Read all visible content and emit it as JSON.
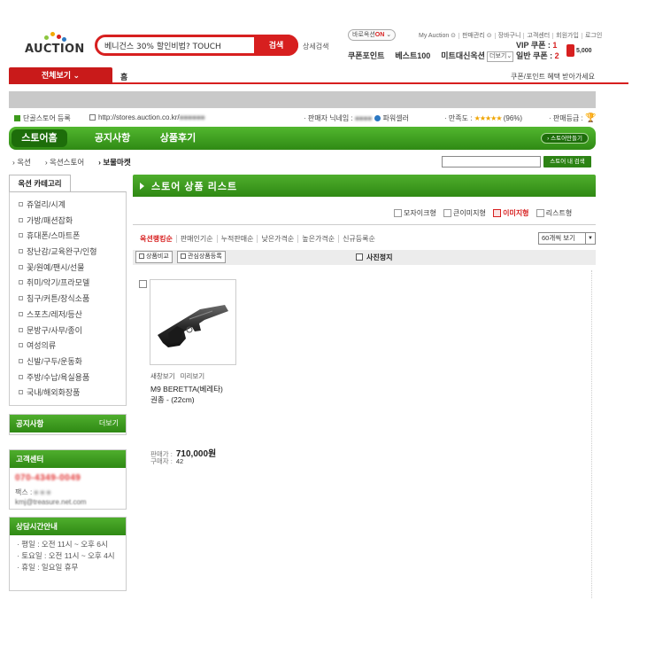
{
  "header": {
    "logo_text": "AUCTION",
    "logo_colors": [
      "#8cc63f",
      "#f2a900",
      "#d71f1f",
      "#2b78c2"
    ],
    "search_value": "베니건스 30% 할인비법? TOUCH",
    "search_button": "검색",
    "detail_search": "상세검색",
    "baro_label": "바로옥션",
    "baro_state": "ON",
    "util_nav": [
      "My Auction ⊙",
      "판매관리 ⊙",
      "장바구니",
      "고객센터",
      "회원가입",
      "로그인"
    ],
    "top_links": [
      "쿠폰포인트",
      "베스트100",
      "미트대신옥션"
    ],
    "more_select": "더보기",
    "vip_coupon_label": "VIP 쿠폰 :",
    "vip_coupon_count": "1",
    "normal_coupon_label": "일반 쿠폰 :",
    "normal_coupon_count": "2",
    "coupon_value": "5,000"
  },
  "redbar": {
    "all_view": "전체보기 ⌄",
    "home": "홈",
    "coupon_msg": "쿠폰/포인트 혜택 받아가세요"
  },
  "store_info": {
    "fav_store": "단골스토어 등록",
    "url": "http://stores.auction.co.kr/",
    "seller_label": "판매자 닉네임 :",
    "power_seller": "파워셀러",
    "satisfaction_label": "만족도 :",
    "satisfaction_stars": "★★★★★",
    "satisfaction_pct": "(96%)",
    "grade_label": "판매등급 :"
  },
  "store_nav": {
    "tabs": [
      "스토어홈",
      "공지사항",
      "상품후기"
    ],
    "make_store": "› 스토어만들기"
  },
  "breadcrumb": {
    "items": [
      "옥션",
      "옥션스토어",
      "보물마켓"
    ],
    "search_button": "스토어 내 검색"
  },
  "sidebar": {
    "category_tab": "옥션 카테고리",
    "categories": [
      "쥬얼리/시계",
      "가방/패션잡화",
      "휴대폰/스마트폰",
      "장난감/교육완구/인형",
      "꽃/원예/팬시/선물",
      "취미/악기/프라모델",
      "침구/커튼/장식소품",
      "스포츠/레저/등산",
      "문방구/사무/종이",
      "여성의류",
      "신발/구두/운동화",
      "주방/수납/욕실용품",
      "국내/해외화장품"
    ],
    "notice_title": "공지사항",
    "notice_more": "더보기",
    "cs_title": "고객센터",
    "cs_phone": "070-4349-0049",
    "cs_fax": "팩스 :",
    "cs_mail": "kmj@treasure.net.com",
    "hours_title": "상담시간안내",
    "hours": [
      "· 평일 : 오전 11시 ~ 오후 6시",
      "· 토요일 : 오전 11시 ~ 오후 4시",
      "· 휴일 : 일요일 휴무"
    ]
  },
  "main": {
    "list_title": "스토어 상품 리스트",
    "view_modes": [
      "모자이크형",
      "큰이미지형",
      "이미지형",
      "리스트형"
    ],
    "active_view": "이미지형",
    "sorts": [
      "옥션랭킹순",
      "판매인기순",
      "누적판매순",
      "낮은가격순",
      "높은가격순",
      "신규등록순"
    ],
    "per_page": "60개씩 보기",
    "compare_btn": "상품비교",
    "interest_btn": "관심상품등록",
    "stop_photo": "사진정지",
    "product": {
      "links": [
        "새창보기",
        "미리보기"
      ],
      "name": "M9 BERETTA(베레타)",
      "sub": "권총 - (22cm)",
      "price_label": "판매가 :",
      "price": "710,000원",
      "buyers_label": "구매자 :",
      "buyers": "42"
    }
  }
}
